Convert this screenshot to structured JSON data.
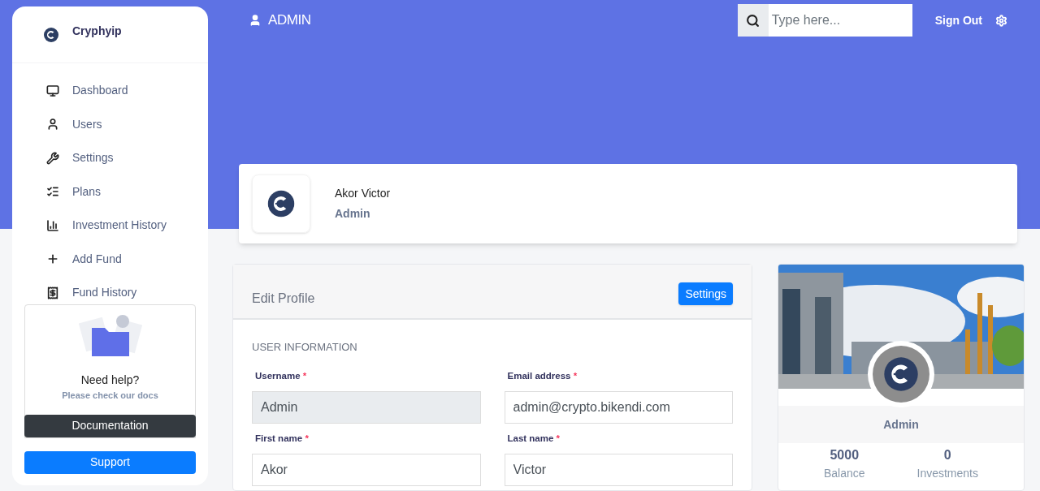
{
  "brand": {
    "name": "Cryphyip"
  },
  "sidebar": {
    "items": [
      {
        "label": "Dashboard"
      },
      {
        "label": "Users"
      },
      {
        "label": "Settings"
      },
      {
        "label": "Plans"
      },
      {
        "label": "Investment History"
      },
      {
        "label": "Add Fund"
      },
      {
        "label": "Fund History"
      }
    ]
  },
  "help_card": {
    "title": "Need help?",
    "subtitle": "Please check our docs",
    "button": "Documentation"
  },
  "support_button": "Support",
  "topbar": {
    "user": "ADMIN",
    "search_placeholder": "Type here...",
    "sign_out": "Sign Out"
  },
  "profile_header": {
    "name": "Akor Victor",
    "role": "Admin"
  },
  "edit_profile": {
    "title": "Edit Profile",
    "button": "Settings",
    "section": "USER INFORMATION",
    "fields": [
      {
        "label": "Username",
        "required_mark": "*",
        "value": "Admin",
        "disabled": true
      },
      {
        "label": "Email address",
        "required_mark": "*",
        "value": "admin@crypto.bikendi.com",
        "disabled": false
      },
      {
        "label": "First name",
        "required_mark": "*",
        "value": "Akor",
        "disabled": false
      },
      {
        "label": "Last name",
        "required_mark": "*",
        "value": "Victor",
        "disabled": false
      }
    ]
  },
  "profile_card": {
    "name": "Admin",
    "stats": [
      {
        "value": "5000",
        "label": "Balance"
      },
      {
        "value": "0",
        "label": "Investments"
      }
    ]
  }
}
